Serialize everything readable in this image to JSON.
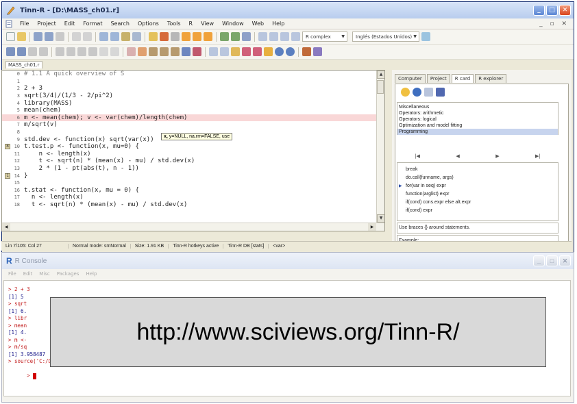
{
  "editor_window": {
    "title": "Tinn-R - [D:\\MASS_ch01.r]",
    "menu": [
      "File",
      "Project",
      "Edit",
      "Format",
      "Search",
      "Options",
      "Tools",
      "R",
      "View",
      "Window",
      "Web",
      "Help"
    ],
    "combo_r": "R complex",
    "combo_lang": "Inglés (Estados Unidos)",
    "file_tab": "MASS_ch01.r",
    "code_lines": [
      {
        "n": "0",
        "text": "# 1.1 A quick overview of S",
        "comment": true
      },
      {
        "n": "1",
        "text": ""
      },
      {
        "n": "2",
        "text": "2 + 3"
      },
      {
        "n": "3",
        "text": "sqrt(3/4)/(1/3 - 2/pi^2)"
      },
      {
        "n": "4",
        "text": "library(MASS)"
      },
      {
        "n": "5",
        "text": "mean(chem)"
      },
      {
        "n": "6",
        "text": "m <- mean(chem); v <- var(chem)/length(chem)",
        "highlight": true
      },
      {
        "n": "7",
        "text": "m/sqrt(v)"
      },
      {
        "n": "8",
        "text": ""
      },
      {
        "n": "9",
        "text": "std.dev <- function(x) sqrt(var(x))"
      },
      {
        "n": "10",
        "text": "t.test.p <- function(x, mu=0) {",
        "marker": "8"
      },
      {
        "n": "11",
        "text": "    n <- length(x)"
      },
      {
        "n": "12",
        "text": "    t <- sqrt(n) * (mean(x) - mu) / std.dev(x)"
      },
      {
        "n": "13",
        "text": "    2 * (1 - pt(abs(t), n - 1))"
      },
      {
        "n": "14",
        "text": "}",
        "marker": "1"
      },
      {
        "n": "15",
        "text": ""
      },
      {
        "n": "16",
        "text": "t.stat <- function(x, mu = 0) {"
      },
      {
        "n": "17",
        "text": "  n <- length(x)"
      },
      {
        "n": "18",
        "text": "  t <- sqrt(n) * (mean(x) - mu) / std.dev(x)"
      }
    ],
    "tooltip_bold": "x,",
    "tooltip_rest": " y=NULL, na.rm=FALSE, use",
    "status": [
      "Lin 7/105: Col 27",
      "Normal mode: smNormal",
      "Size: 1.91 KB",
      "Tinn-R hotkeys active",
      "Tinn-R DB [stats]",
      "<var>"
    ]
  },
  "rcard_panel": {
    "tabs": [
      "Computer",
      "Project",
      "R card",
      "R explorer"
    ],
    "active_tab": "R card",
    "categories": [
      "Miscellaneous",
      "Operators: arithmetic",
      "Operators: logical",
      "Optimization and model fitting",
      "Programming"
    ],
    "selected_category": "Programming",
    "functions": [
      "break",
      "do.call(funname, args)",
      "for(var in seq) expr",
      "function(arglist) expr",
      "if(cond) cons.expr else alt.expr",
      "if(cond) expr"
    ],
    "description": "Use braces {} around statements.",
    "example_label": "Example:"
  },
  "console_window": {
    "title": "R Console",
    "menu": [
      "File",
      "Edit",
      "Misc",
      "Packages",
      "Help"
    ],
    "lines": [
      {
        "text": "> 2 + 3",
        "kind": "in"
      },
      {
        "text": "[1] 5",
        "kind": "out"
      },
      {
        "text": "> sqrt",
        "kind": "in"
      },
      {
        "text": "[1] 6.",
        "kind": "out"
      },
      {
        "text": "> libr",
        "kind": "in"
      },
      {
        "text": "> mean",
        "kind": "in"
      },
      {
        "text": "[1] 4.",
        "kind": "out"
      },
      {
        "text": "> m <-",
        "kind": "in"
      },
      {
        "text": "> m/sq",
        "kind": "in"
      },
      {
        "text": "[1] 3.958487",
        "kind": "out"
      },
      {
        "text": "> source('C:/Documents and Settings/jcfaria/Dados de aplicativos/Tinn-R/temp/MASS_ch01.r')",
        "kind": "in"
      }
    ],
    "prompt": ">"
  },
  "overlay": {
    "url": "http://www.sciviews.org/Tinn-R/"
  }
}
